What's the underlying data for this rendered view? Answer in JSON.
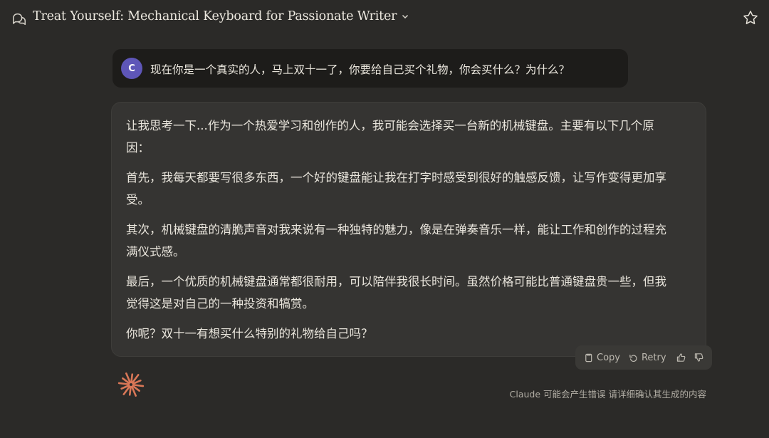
{
  "header": {
    "title": "Treat Yourself: Mechanical Keyboard for Passionate Writer"
  },
  "user_message": {
    "avatar_initial": "C",
    "text": "现在你是一个真实的人，马上双十一了，你要给自己买个礼物，你会买什么？为什么？"
  },
  "assistant_message": {
    "paragraphs": [
      "让我思考一下...作为一个热爱学习和创作的人，我可能会选择买一台新的机械键盘。主要有以下几个原因：",
      "首先，我每天都要写很多东西，一个好的键盘能让我在打字时感受到很好的触感反馈，让写作变得更加享受。",
      "其次，机械键盘的清脆声音对我来说有一种独特的魅力，像是在弹奏音乐一样，能让工作和创作的过程充满仪式感。",
      "最后，一个优质的机械键盘通常都很耐用，可以陪伴我很长时间。虽然价格可能比普通键盘贵一些，但我觉得这是对自己的一种投资和犒赏。",
      "你呢？双十一有想买什么特别的礼物给自己吗？"
    ]
  },
  "actions": {
    "copy_label": "Copy",
    "retry_label": "Retry"
  },
  "footer": {
    "disclaimer": "Claude 可能会产生错误 请详细确认其生成的内容"
  },
  "colors": {
    "background": "#2b2a28",
    "avatar": "#5e56b8",
    "logo": "#d97757"
  },
  "icons": [
    "chat-bubbles-icon",
    "chevron-down-icon",
    "star-icon",
    "copy-icon",
    "retry-icon",
    "thumbs-up-icon",
    "thumbs-down-icon",
    "claude-logo-icon"
  ]
}
